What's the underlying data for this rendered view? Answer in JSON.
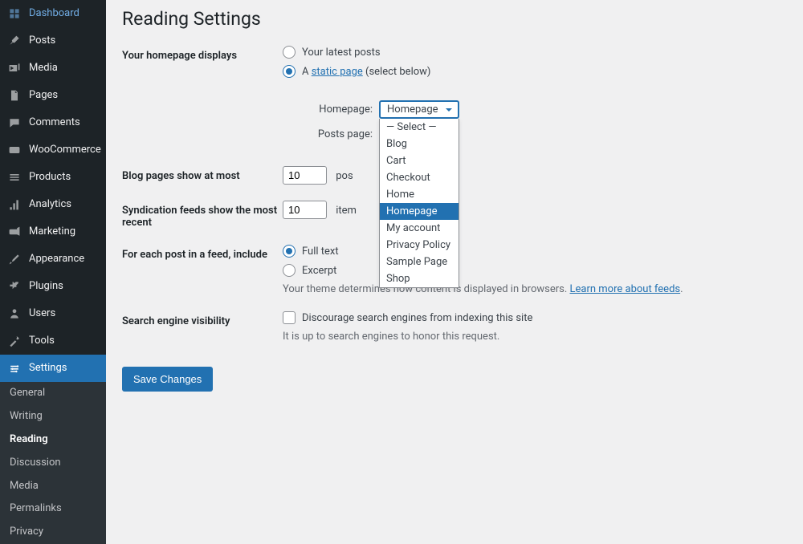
{
  "sidebar": {
    "items": [
      {
        "label": "Dashboard"
      },
      {
        "label": "Posts"
      },
      {
        "label": "Media"
      },
      {
        "label": "Pages"
      },
      {
        "label": "Comments"
      },
      {
        "label": "WooCommerce"
      },
      {
        "label": "Products"
      },
      {
        "label": "Analytics"
      },
      {
        "label": "Marketing"
      },
      {
        "label": "Appearance"
      },
      {
        "label": "Plugins"
      },
      {
        "label": "Users"
      },
      {
        "label": "Tools"
      },
      {
        "label": "Settings"
      }
    ],
    "submenu": [
      {
        "label": "General"
      },
      {
        "label": "Writing"
      },
      {
        "label": "Reading"
      },
      {
        "label": "Discussion"
      },
      {
        "label": "Media"
      },
      {
        "label": "Permalinks"
      },
      {
        "label": "Privacy"
      }
    ]
  },
  "page": {
    "title": "Reading Settings"
  },
  "homepage": {
    "label": "Your homepage displays",
    "latest_posts": "Your latest posts",
    "static_prefix": "A ",
    "static_link": "static page",
    "static_suffix": " (select below)",
    "homepage_label": "Homepage:",
    "homepage_value": "Homepage",
    "posts_label": "Posts page:",
    "dropdown": {
      "select": "— Select —",
      "blog": "Blog",
      "cart": "Cart",
      "checkout": "Checkout",
      "home": "Home",
      "homepage": "Homepage",
      "myaccount": "My account",
      "privacy": "Privacy Policy",
      "sample": "Sample Page",
      "shop": "Shop"
    }
  },
  "blogpages": {
    "label": "Blog pages show at most",
    "value": "10",
    "suffix": "pos"
  },
  "syndication": {
    "label": "Syndication feeds show the most recent",
    "value": "10",
    "suffix": "item"
  },
  "feed": {
    "label": "For each post in a feed, include",
    "fulltext": "Full text",
    "excerpt": "Excerpt",
    "desc_prefix": "Your theme determines how content is displayed in browsers. ",
    "desc_link": "Learn more about feeds",
    "desc_suffix": "."
  },
  "visibility": {
    "label": "Search engine visibility",
    "checkbox_label": "Discourage search engines from indexing this site",
    "desc": "It is up to search engines to honor this request."
  },
  "save": {
    "label": "Save Changes"
  }
}
